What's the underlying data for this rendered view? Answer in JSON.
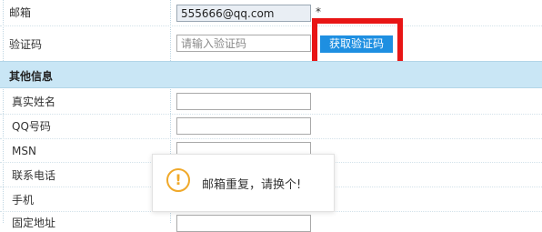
{
  "form": {
    "email": {
      "label": "邮箱",
      "value": "555666@qq.com",
      "required_mark": "*"
    },
    "code": {
      "label": "验证码",
      "placeholder": "请输入验证码",
      "button": "获取验证码"
    },
    "section_title": "其他信息",
    "other_fields": [
      {
        "label": "真实姓名"
      },
      {
        "label": "QQ号码"
      },
      {
        "label": "MSN"
      },
      {
        "label": "联系电话"
      },
      {
        "label": "手机"
      },
      {
        "label": "固定地址"
      }
    ]
  },
  "toast": {
    "icon": "exclamation-circle-icon",
    "message": "邮箱重复，请换个!"
  },
  "colors": {
    "section_bg": "#c9e6f5",
    "button_bg": "#1e8fe1",
    "highlight": "#e81515",
    "warning": "#f0a92a"
  }
}
